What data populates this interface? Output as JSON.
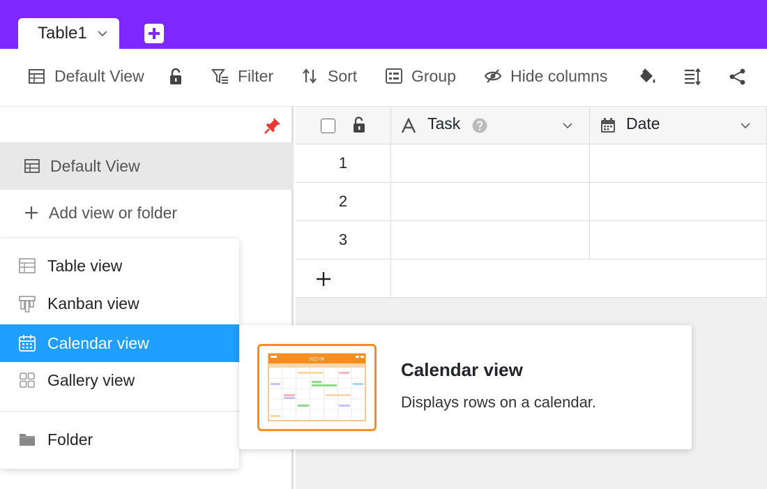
{
  "tabs": {
    "active_label": "Table1"
  },
  "toolbar": {
    "view_label": "Default View",
    "filter_label": "Filter",
    "sort_label": "Sort",
    "group_label": "Group",
    "hide_columns_label": "Hide columns"
  },
  "sidebar": {
    "views": [
      {
        "label": "Default View",
        "icon": "table-icon"
      }
    ],
    "add_label": "Add view or folder"
  },
  "grid": {
    "columns": [
      {
        "label": "Task",
        "type_icon": "text-icon"
      },
      {
        "label": "Date",
        "type_icon": "calendar-icon"
      }
    ],
    "rows": [
      "1",
      "2",
      "3"
    ]
  },
  "menu": {
    "items": [
      {
        "label": "Table view",
        "icon": "table-icon"
      },
      {
        "label": "Kanban view",
        "icon": "kanban-icon"
      },
      {
        "label": "Calendar view",
        "icon": "calendar-icon",
        "selected": true
      },
      {
        "label": "Gallery view",
        "icon": "gallery-icon"
      },
      {
        "label": "Folder",
        "icon": "folder-icon"
      }
    ]
  },
  "preview": {
    "title": "Calendar view",
    "description": "Displays rows on a calendar.",
    "thumbnail_header": "2022-08"
  },
  "colors": {
    "brand": "#7e28ff",
    "selected": "#1f9fff",
    "thumb_accent": "#f68d1f",
    "pin": "#e53935"
  }
}
